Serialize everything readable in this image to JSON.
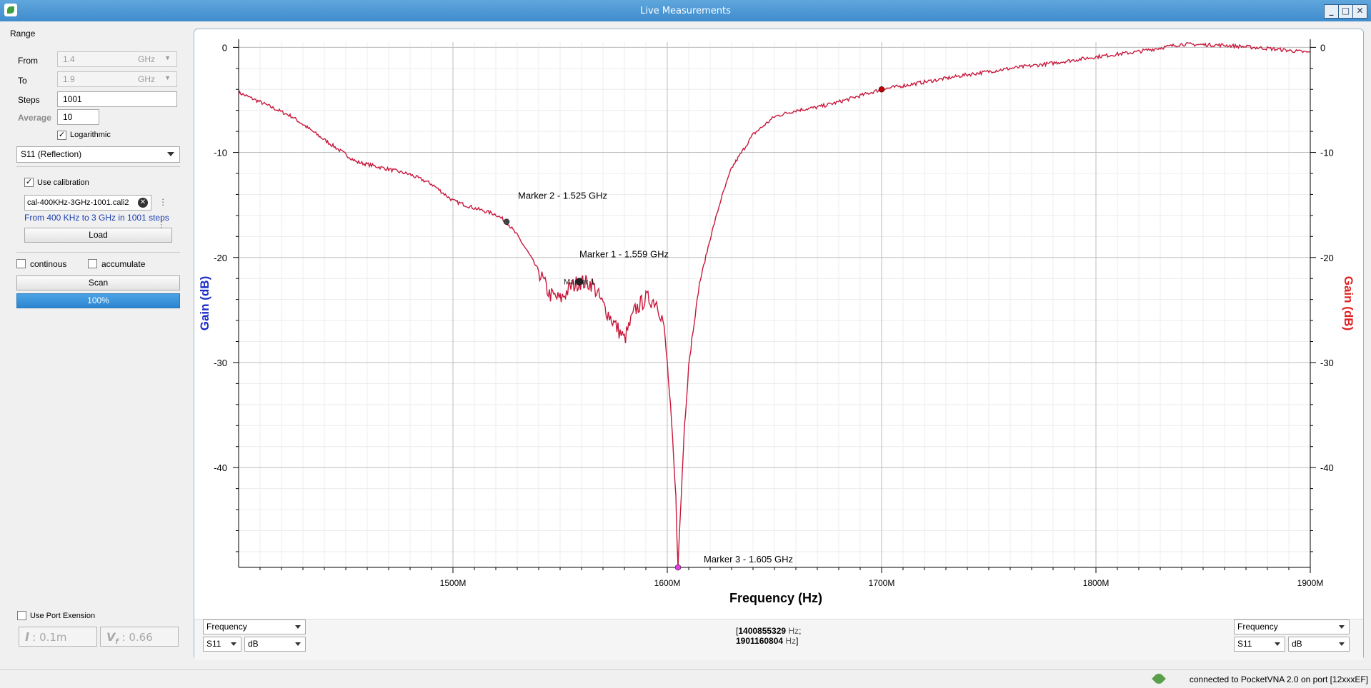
{
  "window": {
    "title": "Live Measurements"
  },
  "left_panel": {
    "range_group_label": "Range",
    "from": {
      "label": "From",
      "value": "1.4",
      "unit": "GHz"
    },
    "to": {
      "label": "To",
      "value": "1.9",
      "unit": "GHz"
    },
    "steps": {
      "label": "Steps",
      "value": "1001"
    },
    "average": {
      "label": "Average",
      "value": "10"
    },
    "logarithmic": {
      "label": "Logarithmic",
      "checked": true
    },
    "parameter_select": "S11 (Reflection)",
    "use_calibration": {
      "label": "Use calibration",
      "checked": true
    },
    "cal_file": "cal-400KHz-3GHz-1001.cali2",
    "cal_info": "From 400 KHz to 3 GHz in 1001 steps",
    "load_label": "Load",
    "continous_label": "continous",
    "accumulate_label": "accumulate",
    "scan_label": "Scan",
    "progress_label": "100%",
    "progress_value": 1.0,
    "port_extension_label": "Use Port Exension",
    "pe_length": "0.1m",
    "pe_vf": "0.66"
  },
  "plot": {
    "left_axis_label": "Gain (dB)",
    "right_axis_label": "Gain (dB)",
    "x_axis_label": "Frequency (Hz)",
    "bottom_left": {
      "x_select": "Frequency",
      "s_select": "S11",
      "unit_select": "dB"
    },
    "bottom_right": {
      "x_select": "Frequency",
      "s_select": "S11",
      "unit_select": "dB"
    },
    "range_start": "1400855329",
    "range_end": "1901160804",
    "hz_unit": "Hz",
    "open_bracket": "[",
    "sep": ";",
    "close_bracket": "]"
  },
  "chart_data": {
    "type": "line",
    "xlabel": "Frequency (Hz)",
    "ylabel": "Gain (dB)",
    "y2label": "Gain (dB)",
    "xlim": [
      1400,
      1900
    ],
    "ylim": [
      -49.5,
      0.5
    ],
    "x_unit": "MHz",
    "x_ticks": [
      1500,
      1600,
      1700,
      1800,
      1900
    ],
    "x_tick_labels": [
      "1500M",
      "1600M",
      "1700M",
      "1800M",
      "1900M"
    ],
    "y_ticks": [
      0,
      -10,
      -20,
      -30,
      -40
    ],
    "y_tick_labels": [
      "0",
      "-10",
      "-20",
      "-30",
      "-40"
    ],
    "grid": true,
    "line_color": "#c8183c",
    "series": [
      {
        "x": [
          1400,
          1410,
          1425,
          1440,
          1455,
          1470,
          1480,
          1490,
          1500,
          1510,
          1520,
          1525,
          1530,
          1535,
          1540,
          1545,
          1550,
          1555,
          1559,
          1565,
          1570,
          1575,
          1580,
          1585,
          1590,
          1595,
          1598,
          1600,
          1602,
          1604,
          1605,
          1606,
          1608,
          1610,
          1612,
          1615,
          1620,
          1625,
          1630,
          1640,
          1650,
          1660,
          1670,
          1680,
          1690,
          1700,
          1720,
          1740,
          1760,
          1780,
          1800,
          1820,
          1840,
          1860,
          1880,
          1900
        ],
        "y": [
          -4.3,
          -5.2,
          -6.6,
          -8.8,
          -10.9,
          -11.6,
          -12.1,
          -13.0,
          -14.6,
          -15.3,
          -15.9,
          -16.6,
          -17.9,
          -19.5,
          -21.3,
          -23.5,
          -24.0,
          -22.8,
          -22.3,
          -22.5,
          -24.5,
          -26.2,
          -27.8,
          -25.0,
          -23.9,
          -24.2,
          -26.0,
          -30.0,
          -36.0,
          -43.0,
          -49.5,
          -45.0,
          -36.0,
          -30.0,
          -27.0,
          -22.5,
          -18.2,
          -14.5,
          -11.5,
          -8.3,
          -6.6,
          -6.0,
          -5.7,
          -5.2,
          -4.6,
          -4.0,
          -3.3,
          -2.6,
          -2.0,
          -1.5,
          -0.9,
          -0.4,
          0.3,
          0.2,
          -0.1,
          -0.5
        ]
      }
    ],
    "markers": [
      {
        "label": "Marker 2 - 1.525 GHz",
        "x": 1525,
        "y": -16.6,
        "color": "#444444"
      },
      {
        "label": "Marker 1 - 1.559 GHz",
        "x": 1559,
        "y": -22.3,
        "color": "#222222",
        "inline": "Marker 1"
      },
      {
        "label": "Marker 3 - 1.605 GHz",
        "x": 1605,
        "y": -49.5,
        "color": "#e040e0"
      },
      {
        "label": "",
        "x": 1700,
        "y": -4.0,
        "color": "#c00000"
      }
    ]
  }
}
